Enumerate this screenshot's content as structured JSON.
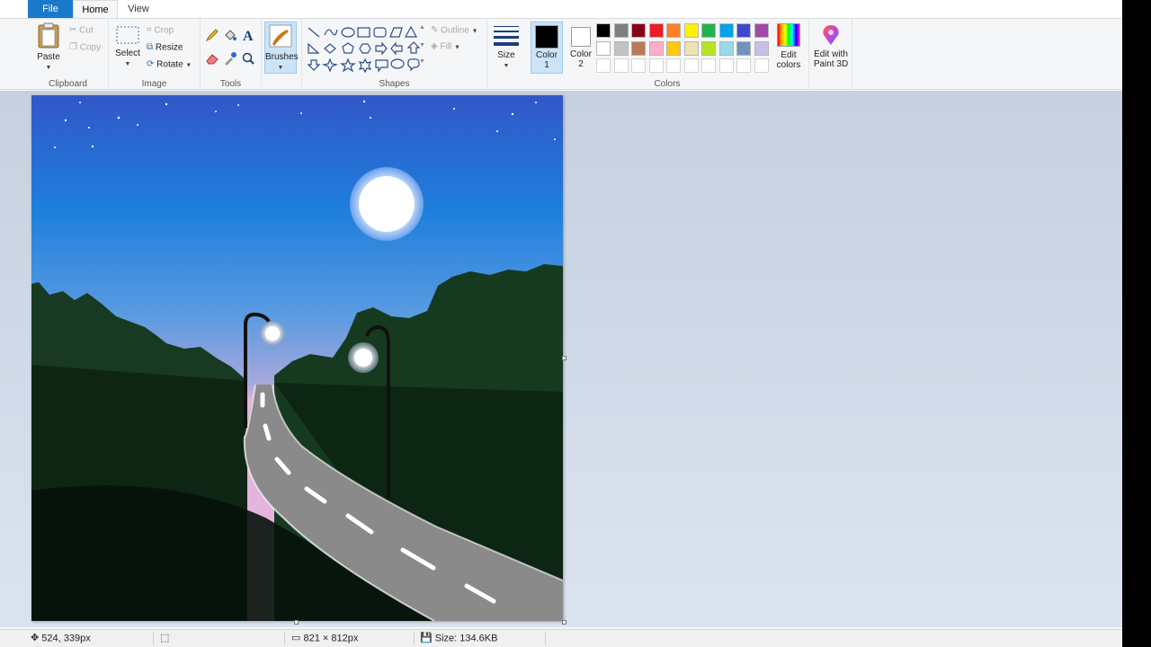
{
  "tabs": {
    "file": "File",
    "home": "Home",
    "view": "View"
  },
  "clipboard": {
    "paste": "Paste",
    "cut": "Cut",
    "copy": "Copy",
    "label": "Clipboard"
  },
  "image": {
    "select": "Select",
    "crop": "Crop",
    "resize": "Resize",
    "rotate": "Rotate",
    "label": "Image"
  },
  "tools": {
    "label": "Tools"
  },
  "brushes": {
    "label": "Brushes"
  },
  "shapes": {
    "label": "Shapes",
    "outline": "Outline",
    "fill": "Fill"
  },
  "size": {
    "label": "Size"
  },
  "colors": {
    "color1_line1": "Color",
    "color1_line2": "1",
    "color2_line1": "Color",
    "color2_line2": "2",
    "edit_line1": "Edit",
    "edit_line2": "colors",
    "label": "Colors",
    "color1_value": "#000000",
    "color2_value": "#ffffff",
    "palette_row1": [
      "#000000",
      "#7f7f7f",
      "#880015",
      "#ed1c24",
      "#ff7f27",
      "#fff200",
      "#22b14c",
      "#00a2e8",
      "#3f48cc",
      "#a349a4"
    ],
    "palette_row2": [
      "#ffffff",
      "#c3c3c3",
      "#b97a57",
      "#ffaec9",
      "#ffc90e",
      "#efe4b0",
      "#b5e61d",
      "#99d9ea",
      "#7092be",
      "#c8bfe7"
    ]
  },
  "paint3d": {
    "line1": "Edit with",
    "line2": "Paint 3D"
  },
  "status": {
    "cursor": "524, 339px",
    "dimensions": "821 × 812px",
    "size": "Size: 134.6KB"
  }
}
